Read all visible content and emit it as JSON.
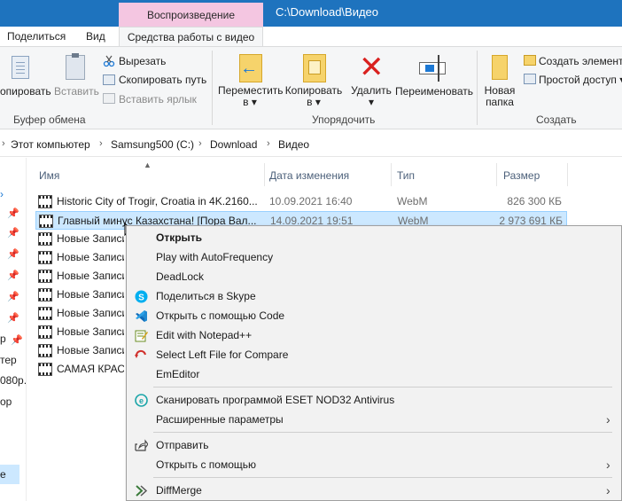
{
  "window": {
    "context_tab_header": "Воспроизведение",
    "title": "C:\\Download\\Видео"
  },
  "tabs": {
    "share": "Поделиться",
    "view": "Вид",
    "video_tools": "Средства работы с видео"
  },
  "ribbon": {
    "clipboard": {
      "copy_fragment": "опировать",
      "paste": "Вставить",
      "cut": "Вырезать",
      "copy_path": "Скопировать путь",
      "paste_shortcut": "Вставить ярлык",
      "group_label": "Буфер обмена"
    },
    "organize": {
      "move_to_line1": "Переместить",
      "move_to_line2": "в",
      "copy_to_line1": "Копировать",
      "copy_to_line2": "в",
      "delete": "Удалить",
      "rename": "Переименовать",
      "group_label": "Упорядочить"
    },
    "create": {
      "new_folder_line1": "Новая",
      "new_folder_line2": "папка",
      "new_item": "Создать элемент",
      "easy_access": "Простой доступ",
      "group_label": "Создать"
    }
  },
  "address": {
    "crumbs": [
      "Этот компьютер",
      "Samsung500 (C:)",
      "Download",
      "Видео"
    ]
  },
  "nav_fragments": [
    "р",
    "тер",
    "080р.",
    "ор",
    "е"
  ],
  "columns": {
    "name": "Имя",
    "date": "Дата изменения",
    "type": "Тип",
    "size": "Размер"
  },
  "files": [
    {
      "name": "Historic City of Trogir, Croatia in 4K.2160...",
      "date": "10.09.2021 16:40",
      "type": "WebM",
      "size": "826 300 КБ"
    },
    {
      "name": "Главный минус Казахстана! [Пора Вал...",
      "date": "14.09.2021 19:51",
      "type": "WebM",
      "size": "2 973 691 КБ"
    },
    {
      "name": "Новые Записи",
      "date": "",
      "type": "",
      "size": ""
    },
    {
      "name": "Новые Записи",
      "date": "",
      "type": "",
      "size": ""
    },
    {
      "name": "Новые Записи",
      "date": "",
      "type": "",
      "size": ""
    },
    {
      "name": "Новые Записи",
      "date": "",
      "type": "",
      "size": ""
    },
    {
      "name": "Новые Записи",
      "date": "",
      "type": "",
      "size": ""
    },
    {
      "name": "Новые Записи",
      "date": "",
      "type": "",
      "size": ""
    },
    {
      "name": "Новые Записи",
      "date": "",
      "type": "",
      "size": ""
    },
    {
      "name": "САМАЯ КРАС",
      "date": "",
      "type": "",
      "size": ""
    }
  ],
  "context_menu": {
    "open": "Открыть",
    "play_af": "Play with AutoFrequency",
    "deadlock": "DeadLock",
    "share_skype": "Поделиться в Skype",
    "open_code": "Открыть с помощью Code",
    "notepadpp": "Edit with Notepad++",
    "compare": "Select Left File for Compare",
    "emeditor": "EmEditor",
    "eset": "Сканировать программой ESET NOD32 Antivirus",
    "advanced": "Расширенные параметры",
    "send": "Отправить",
    "open_with": "Открыть с помощью",
    "diffmerge": "DiffMerge"
  },
  "colors": {
    "titlebar": "#1e73be",
    "context_tab": "#f4c6e1",
    "selection": "#cce8ff",
    "delete_red": "#d9211f",
    "accent_blue": "#1c78d4"
  }
}
